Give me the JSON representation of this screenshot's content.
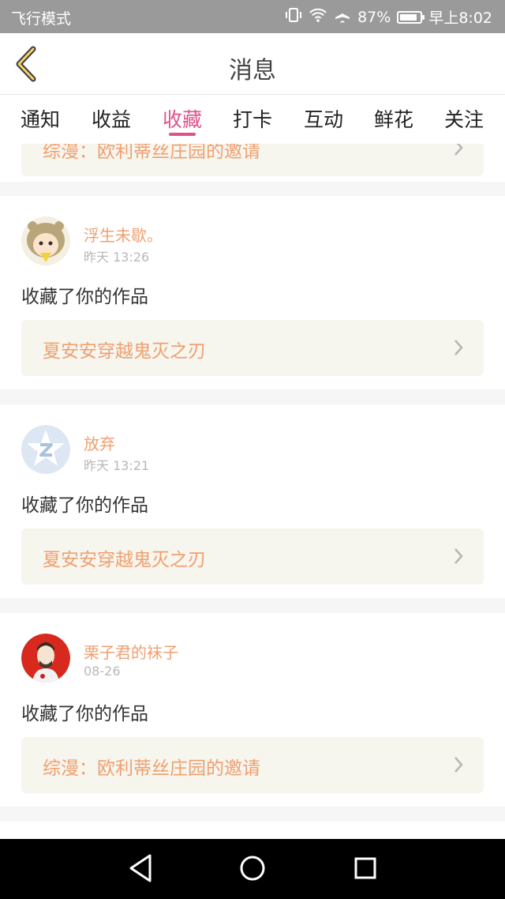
{
  "status_bar": {
    "mode": "飞行模式",
    "battery": "87%",
    "time": "早上8:02",
    "battery_level": 0.87
  },
  "header": {
    "title": "消息"
  },
  "tabs": [
    {
      "label": "通知"
    },
    {
      "label": "收益"
    },
    {
      "label": "收藏",
      "active": true
    },
    {
      "label": "打卡"
    },
    {
      "label": "互动"
    },
    {
      "label": "鲜花"
    },
    {
      "label": "关注"
    }
  ],
  "partial_top_card": {
    "work_title": "综漫：欧利蒂丝庄园的邀请"
  },
  "messages": [
    {
      "username": "浮生未歇。",
      "time": "昨天 13:26",
      "action": "收藏了你的作品",
      "work_title": "夏安安穿越鬼灭之刃",
      "avatar_icon": "cartoon-boy-avatar"
    },
    {
      "username": "放弃",
      "time": "昨天 13:21",
      "action": "收藏了你的作品",
      "work_title": "夏安安穿越鬼灭之刃",
      "avatar_icon": "default-z-avatar"
    },
    {
      "username": "栗子君的袜子",
      "time": "08-26",
      "action": "收藏了你的作品",
      "work_title": "综漫：欧利蒂丝庄园的邀请",
      "avatar_icon": "red-character-avatar"
    }
  ],
  "colors": {
    "accent": "#e0528d",
    "username": "#f0a070",
    "work_title": "#f0a070",
    "work_box_bg": "#f6f5ee"
  }
}
